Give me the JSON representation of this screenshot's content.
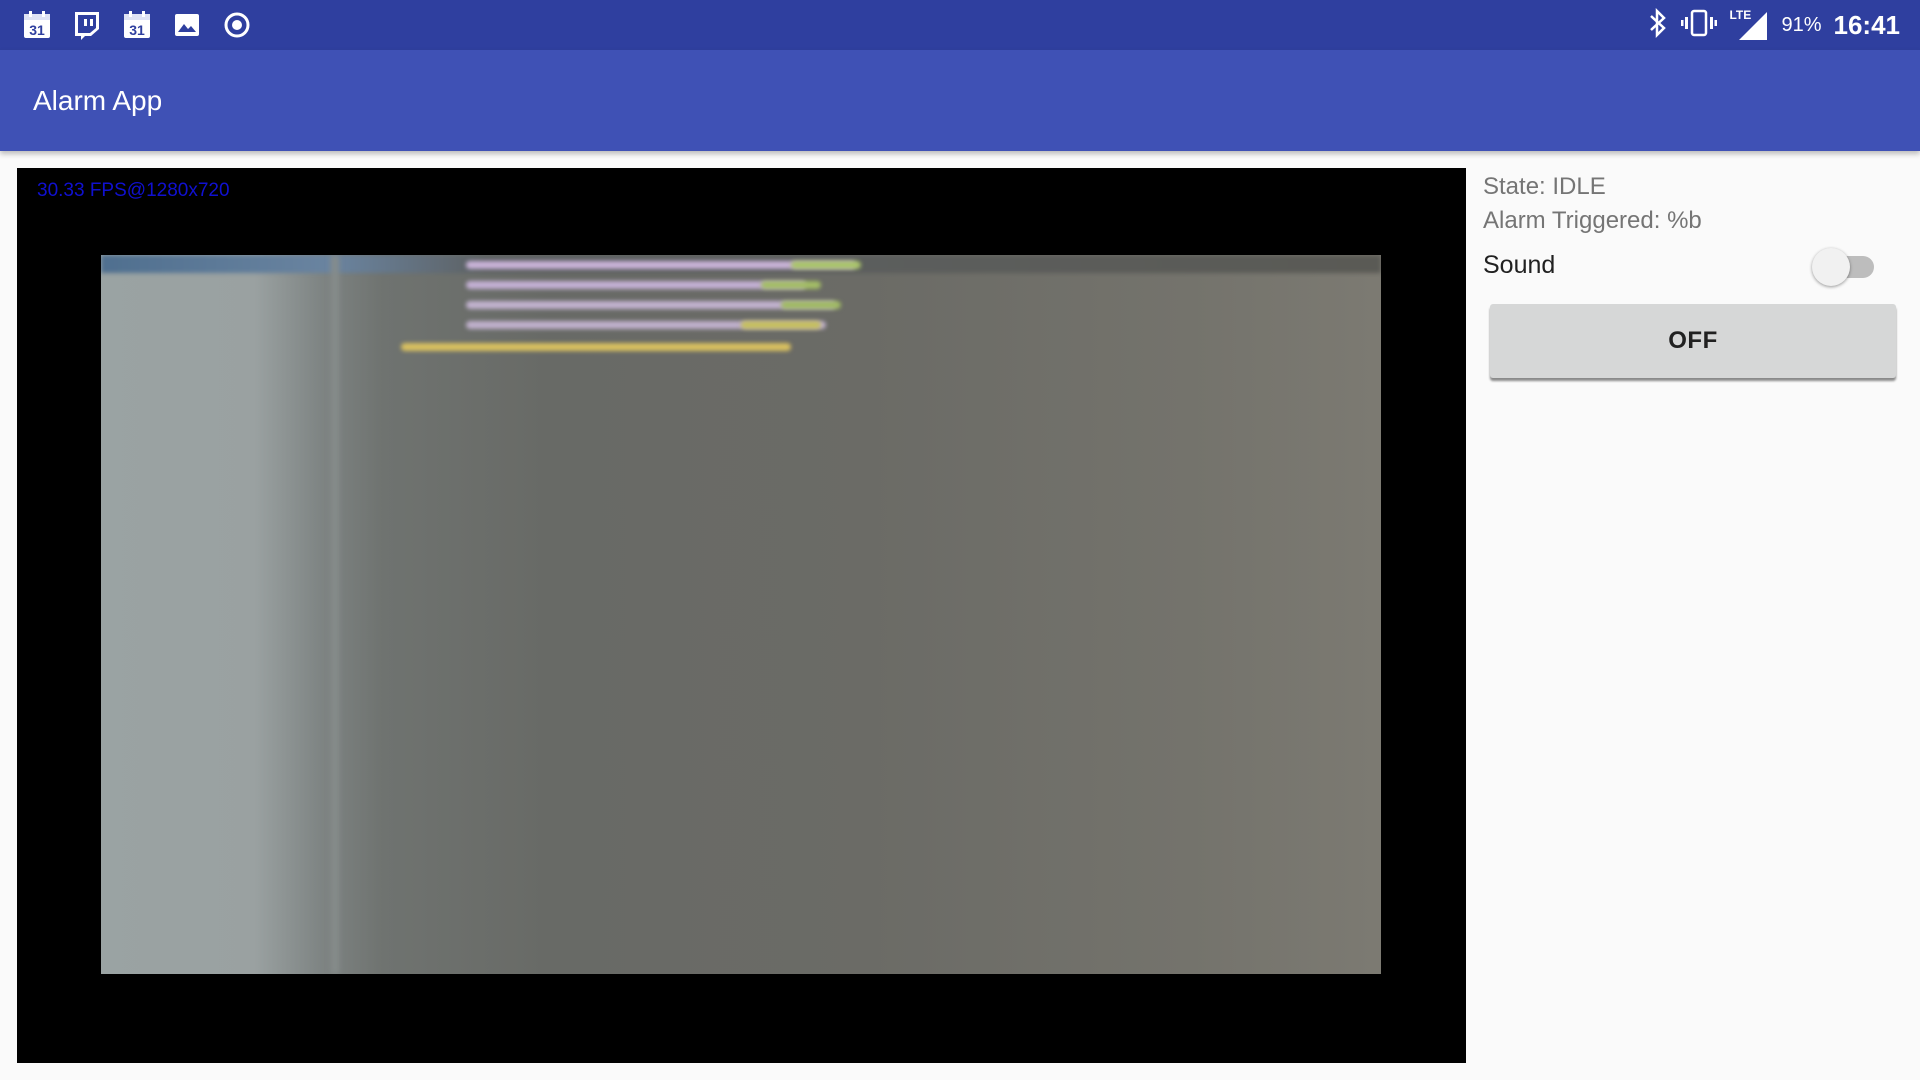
{
  "status_bar": {
    "notification_icons": [
      "calendar-icon",
      "twitch-icon",
      "calendar-icon",
      "image-icon",
      "record-icon"
    ],
    "calendar_day": "31",
    "network_label": "LTE",
    "battery": "91%",
    "time": "16:41"
  },
  "app_bar": {
    "title": "Alarm App"
  },
  "camera": {
    "fps_overlay": "30.33 FPS@1280x720"
  },
  "panel": {
    "state": "State: IDLE",
    "alarm_triggered": "Alarm Triggered: %b",
    "sound_label": "Sound",
    "sound_enabled": false,
    "button_label": "OFF"
  },
  "colors": {
    "status_bar": "#2f3f9f",
    "app_bar": "#3f51b5",
    "background": "#fafafa",
    "fps_text": "#1010d0",
    "button": "#d6d7d7"
  }
}
